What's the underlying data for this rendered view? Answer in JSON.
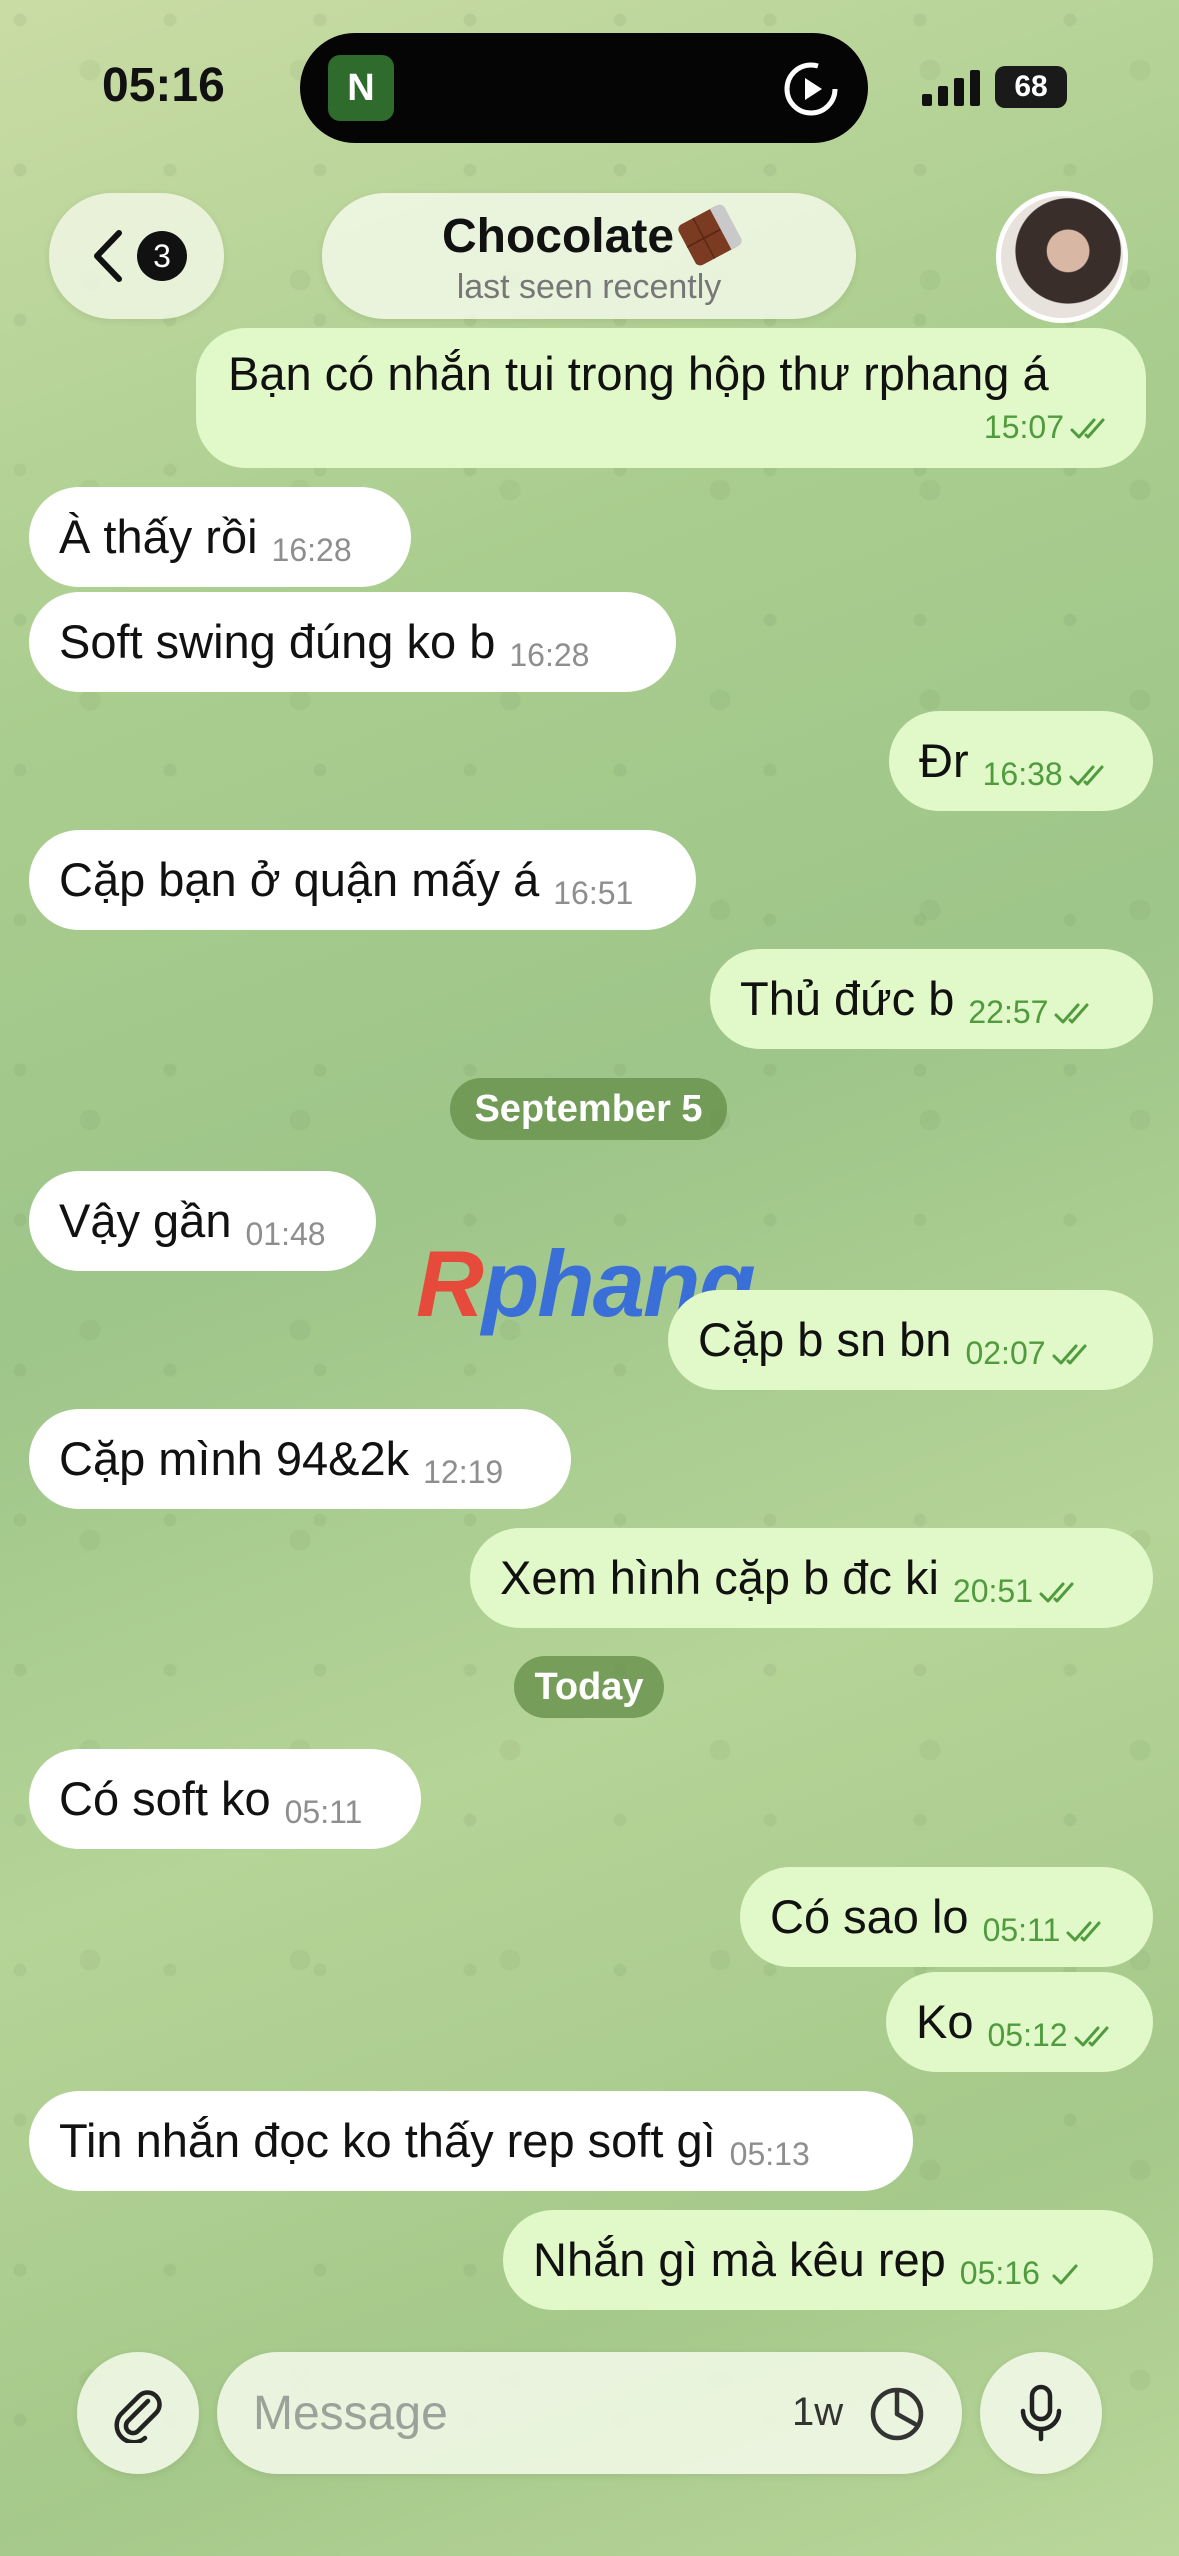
{
  "status_bar": {
    "time": "05:16",
    "island_app_letter": "N",
    "battery": "68"
  },
  "header": {
    "back_badge": "3",
    "title": "Chocolate",
    "status": "last seen recently",
    "title_emoji_icon": "chocolate-bar-icon"
  },
  "messages": [
    {
      "text": "Bạn có nhắn tui trong hộp thư rphang á",
      "time": "15:07",
      "direction": "out",
      "read": true
    },
    {
      "text": "À thấy rồi",
      "time": "16:28",
      "direction": "in"
    },
    {
      "text": "Soft swing đúng ko b",
      "time": "16:28",
      "direction": "in"
    },
    {
      "text": "Đr",
      "time": "16:38",
      "direction": "out",
      "read": true
    },
    {
      "text": "Cặp bạn ở quận mấy á",
      "time": "16:51",
      "direction": "in"
    },
    {
      "text": "Thủ đức b",
      "time": "22:57",
      "direction": "out",
      "read": true
    },
    {
      "text": "Vậy gần",
      "time": "01:48",
      "direction": "in"
    },
    {
      "text": "Cặp b sn bn",
      "time": "02:07",
      "direction": "out",
      "read": true
    },
    {
      "text": "Cặp mình 94&2k",
      "time": "12:19",
      "direction": "in"
    },
    {
      "text": "Xem hình cặp b đc ki",
      "time": "20:51",
      "direction": "out",
      "read": true
    },
    {
      "text": "Có soft ko",
      "time": "05:11",
      "direction": "in"
    },
    {
      "text": "Có sao lo",
      "time": "05:11",
      "direction": "out",
      "read": true
    },
    {
      "text": "Ko",
      "time": "05:12",
      "direction": "out",
      "read": true
    },
    {
      "text": "Tin nhắn đọc ko thấy rep soft gì",
      "time": "05:13",
      "direction": "in"
    },
    {
      "text": "Nhắn gì mà kêu rep",
      "time": "05:16",
      "direction": "out",
      "read": false
    }
  ],
  "date_separators": [
    "September 5",
    "Today"
  ],
  "watermark": {
    "r": "R",
    "rest": "phang"
  },
  "composer": {
    "placeholder": "Message",
    "timer_label": "1w"
  },
  "colors": {
    "incoming_bubble": "#ffffff",
    "outgoing_bubble": "#e1f8c8",
    "outgoing_meta": "#4f9b3e"
  }
}
